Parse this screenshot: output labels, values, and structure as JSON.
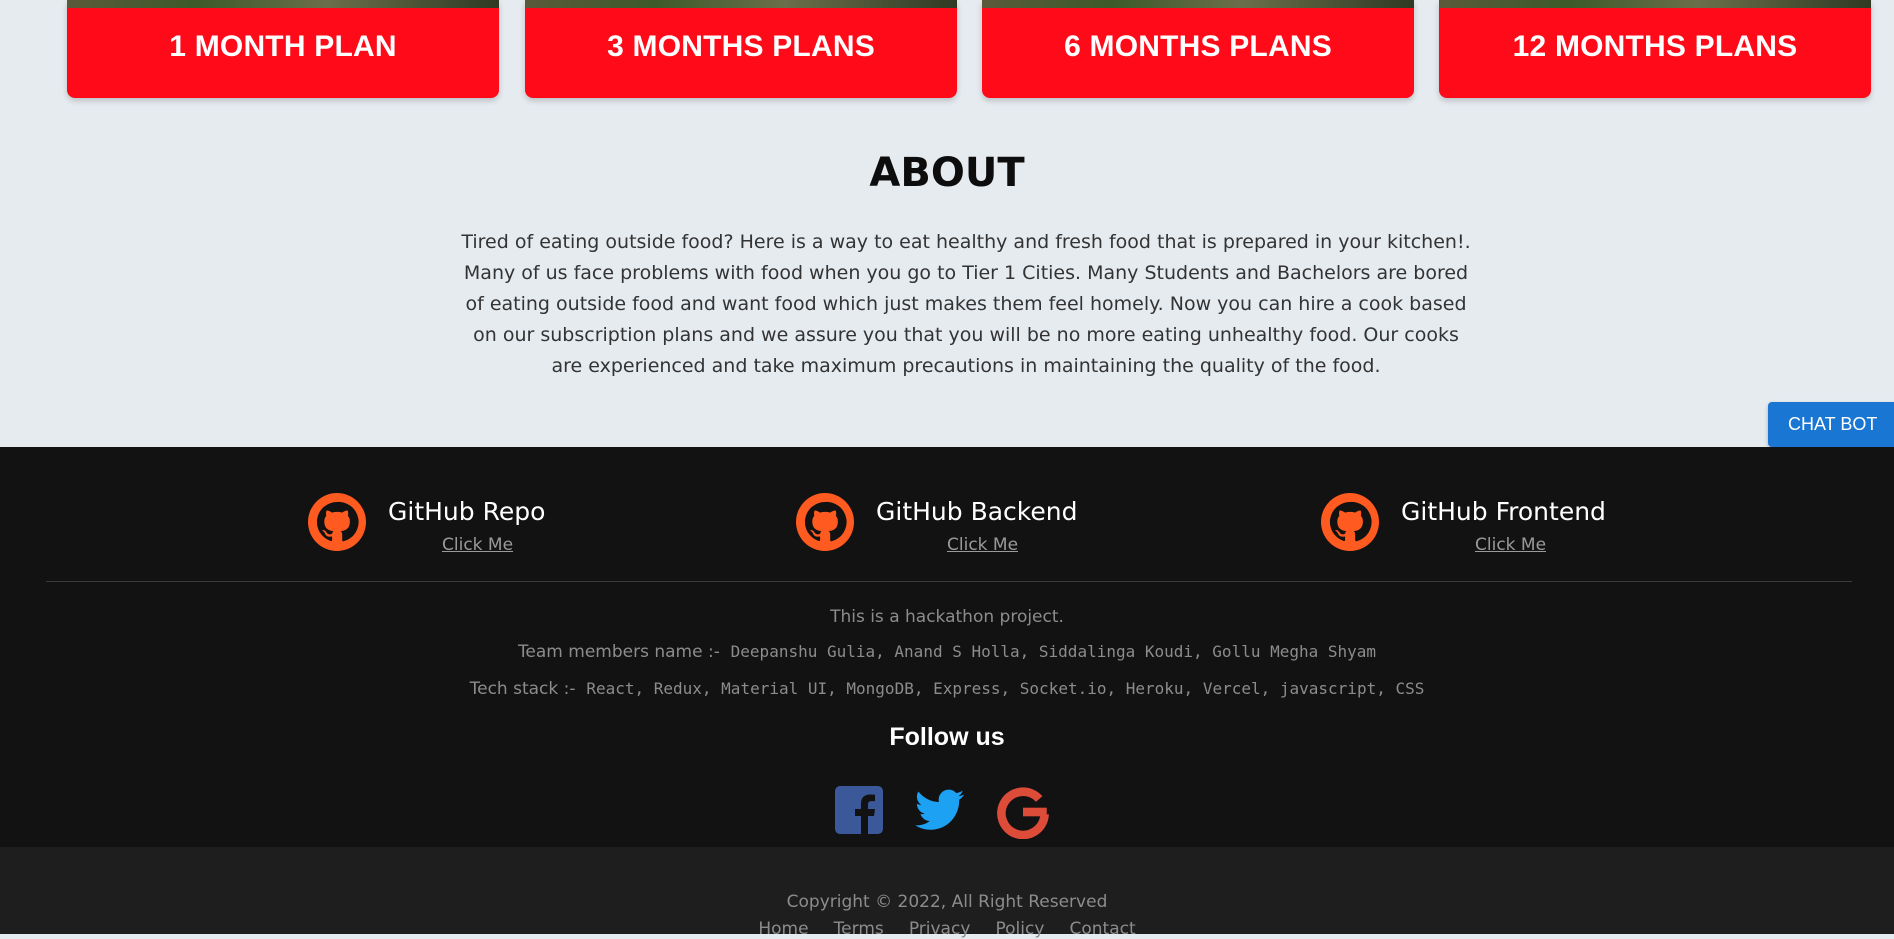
{
  "plans": [
    {
      "title": "1 MONTH PLAN"
    },
    {
      "title": "3 MONTHS PLANS"
    },
    {
      "title": "6 MONTHS PLANS"
    },
    {
      "title": "12 MONTHS PLANS"
    }
  ],
  "about": {
    "title": "ABOUT",
    "text": "Tired of eating outside food? Here is a way to eat healthy and fresh food that is prepared in your kitchen!. Many of us face problems with food when you go to Tier 1 Cities. Many Students and Bachelors are bored of eating outside food and want food which just makes them feel homely. Now you can hire a cook based on our subscription plans and we assure you that you will be no more eating unhealthy food. Our cooks are experienced and take maximum precautions in maintaining the quality of the food."
  },
  "chat_bot": {
    "label": "CHAT BOT"
  },
  "footer": {
    "links": [
      {
        "title": "GitHub Repo",
        "action": "Click Me"
      },
      {
        "title": "GitHub Backend",
        "action": "Click Me"
      },
      {
        "title": "GitHub Frontend",
        "action": "Click Me"
      }
    ],
    "hackathon": "This is a hackathon project.",
    "team_label": "Team members name :-",
    "team": "Deepanshu Gulia, Anand S Holla, Siddalinga Koudi, Gollu Megha Shyam",
    "tech_label": "Tech stack :-",
    "tech": "React, Redux, Material UI, MongoDB, Express, Socket.io, Heroku, Vercel, javascript, CSS",
    "follow": "Follow us",
    "social_icons": [
      "facebook-icon",
      "twitter-icon",
      "google-icon"
    ]
  },
  "bottom": {
    "copyright": "Copyright © 2022, All Right Reserved",
    "nav": [
      "Home",
      "Terms",
      "Privacy",
      "Policy",
      "Contact"
    ]
  },
  "colors": {
    "plan_red": "#ff0a19",
    "github_orange": "#ff5a1f",
    "chat_blue": "#1976d2",
    "footer_bg": "#121212",
    "facebook": "#3b5998",
    "twitter": "#1da1f2",
    "google": "#dd4b39"
  }
}
